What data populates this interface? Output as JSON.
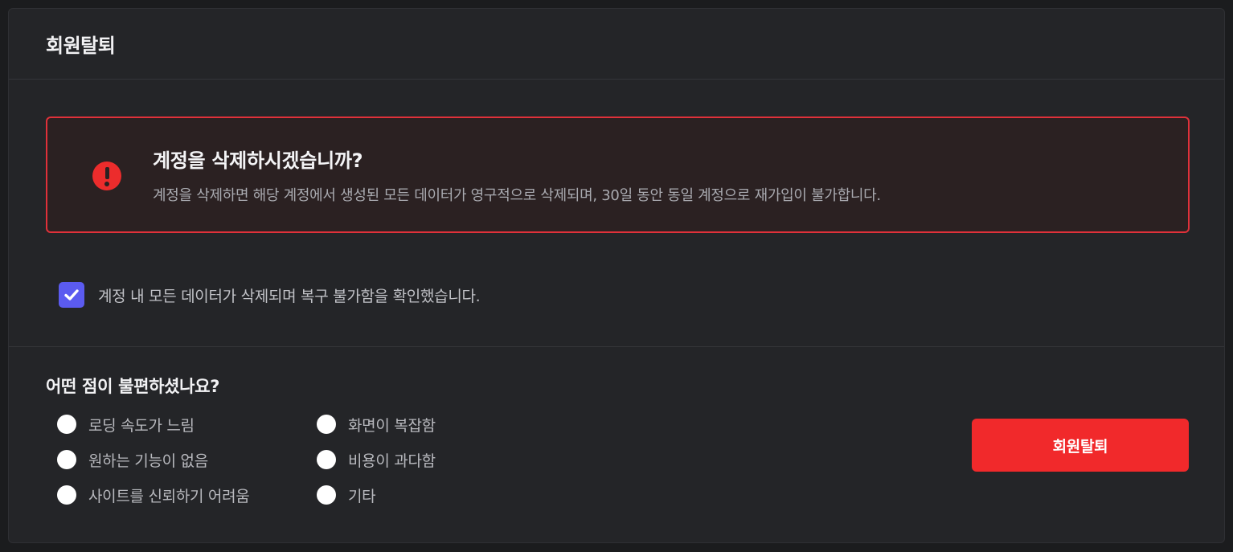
{
  "header": {
    "title": "회원탈퇴"
  },
  "warning": {
    "title": "계정을 삭제하시겠습니까?",
    "description": "계정을 삭제하면 해당 계정에서 생성된 모든 데이터가 영구적으로 삭제되며, 30일 동안 동일 계정으로 재가입이 불가합니다.",
    "icon": "exclamation-circle-icon",
    "color": "#e0313a"
  },
  "confirm": {
    "label": "계정 내 모든 데이터가 삭제되며 복구 불가함을 확인했습니다.",
    "checked": true,
    "color": "#5b5bf0"
  },
  "survey": {
    "title": "어떤 점이 불편하셨나요?",
    "options": [
      "로딩 속도가 느림",
      "원하는 기능이 없음",
      "사이트를 신뢰하기 어려움",
      "화면이 복잡함",
      "비용이 과다함",
      "기타"
    ]
  },
  "actions": {
    "withdraw_label": "회원탈퇴",
    "color": "#f1292b"
  }
}
